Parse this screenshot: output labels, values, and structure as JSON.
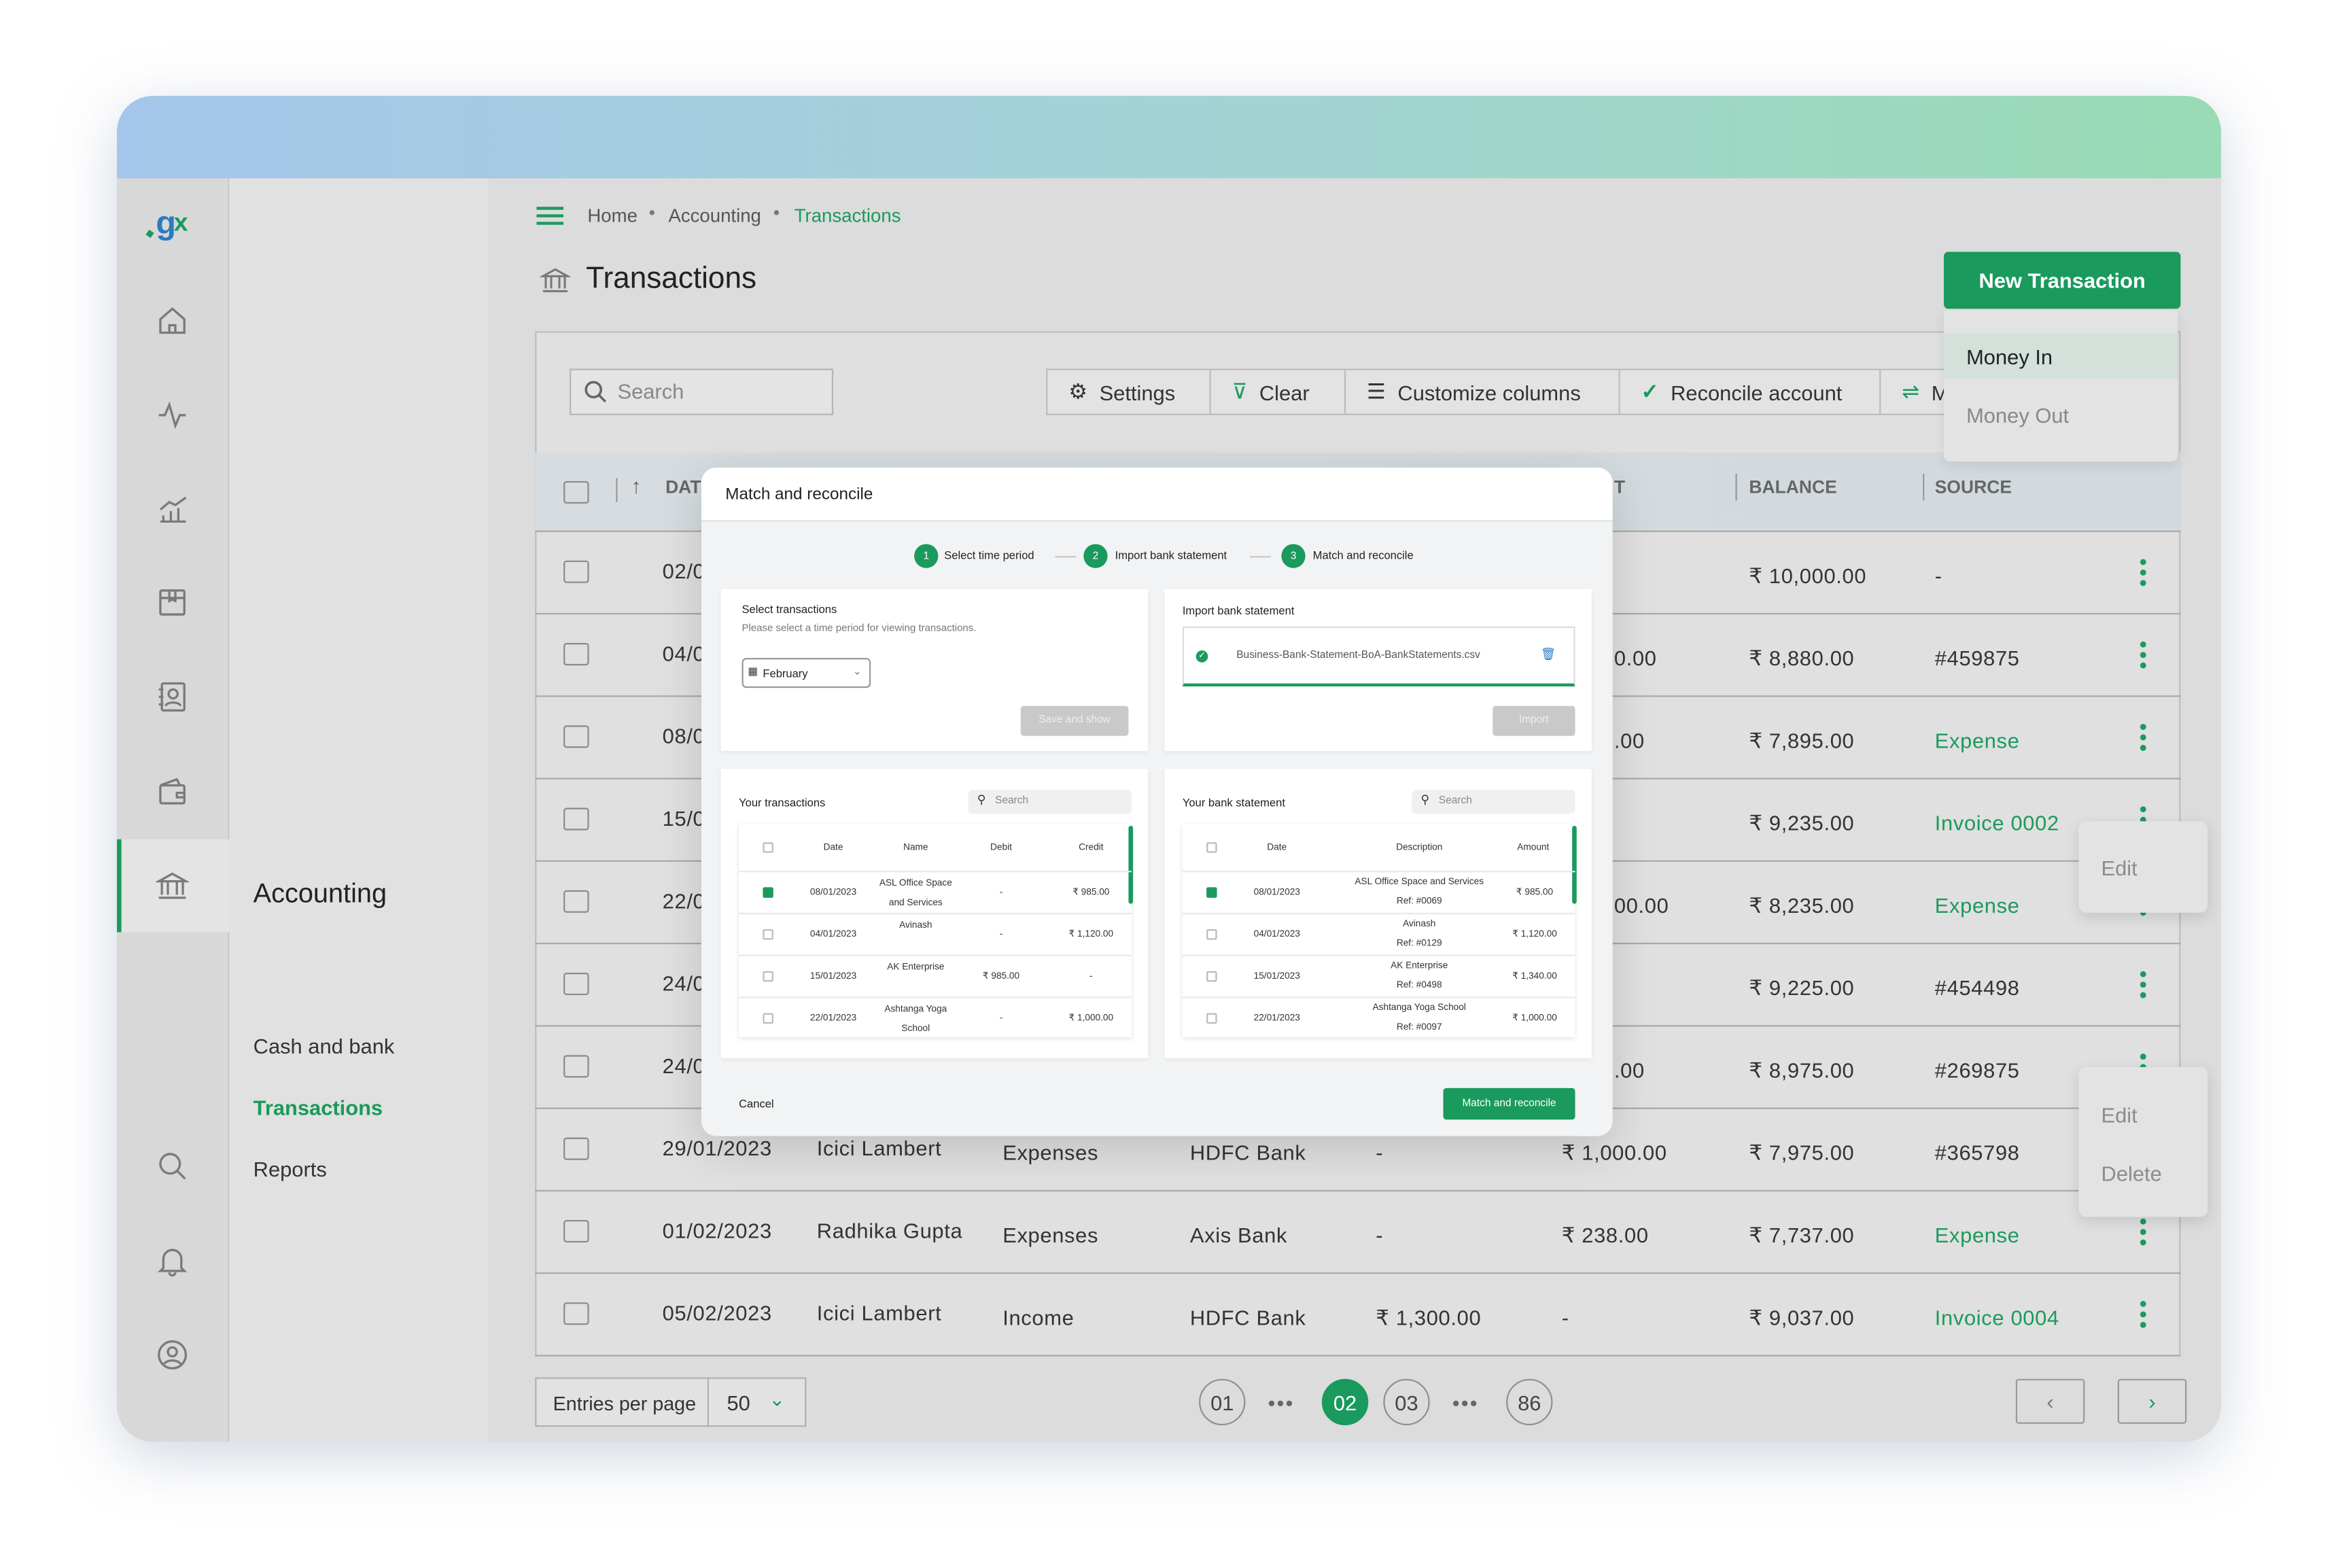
{
  "app": {
    "logo_text": "gx",
    "brand_colors": {
      "accent": "#1a9a5c",
      "logo_blue": "#2a7bc0"
    }
  },
  "sidebar": {
    "rail_icons": [
      "home-icon",
      "activity-icon",
      "chart-icon",
      "box-icon",
      "contacts-icon",
      "wallet-icon",
      "bank-icon",
      "search-icon",
      "bell-icon",
      "user-icon"
    ],
    "section_title": "Accounting",
    "items": [
      {
        "label": "Cash and bank",
        "active": false
      },
      {
        "label": "Transactions",
        "active": true
      },
      {
        "label": "Reports",
        "active": false
      }
    ]
  },
  "breadcrumb": {
    "items": [
      "Home",
      "Accounting",
      "Transactions"
    ]
  },
  "page": {
    "title": "Transactions"
  },
  "new_transaction": {
    "label": "New Transaction",
    "menu": [
      "Money In",
      "Money Out"
    ]
  },
  "toolbar": {
    "search_placeholder": "Search",
    "buttons": [
      "Settings",
      "Clear",
      "Customize columns",
      "Reconcile account",
      "M"
    ]
  },
  "table": {
    "headers": {
      "date": "DAT",
      "amount_fragment": "T",
      "balance": "BALANCE",
      "source": "SOURCE"
    },
    "rows": [
      {
        "date": "02/0",
        "credit_fragment": "",
        "balance": "₹ 10,000.00",
        "source": "-",
        "source_link": false
      },
      {
        "date": "04/0",
        "credit_fragment": "0.00",
        "balance": "₹ 8,880.00",
        "source": "#459875",
        "source_link": false
      },
      {
        "date": "08/0",
        "credit_fragment": ".00",
        "balance": "₹ 7,895.00",
        "source": "Expense",
        "source_link": true
      },
      {
        "date": "15/0",
        "credit_fragment": "",
        "balance": "₹ 9,235.00",
        "source": "Invoice 0002",
        "source_link": true
      },
      {
        "date": "22/0",
        "credit_fragment": "00.00",
        "balance": "₹ 8,235.00",
        "source": "Expense",
        "source_link": true
      },
      {
        "date": "24/0",
        "credit_fragment": "",
        "balance": "₹ 9,225.00",
        "source": "#454498",
        "source_link": false
      },
      {
        "date": "24/0",
        "credit_fragment": ".00",
        "balance": "₹ 8,975.00",
        "source": "#269875",
        "source_link": false
      },
      {
        "date": "29/01/2023",
        "name": "Icici Lambert",
        "category": "Expenses",
        "bank": "HDFC Bank",
        "debit": "-",
        "credit": "₹ 1,000.00",
        "balance": "₹ 7,975.00",
        "source": "#365798",
        "source_link": false
      },
      {
        "date": "01/02/2023",
        "name": "Radhika Gupta",
        "category": "Expenses",
        "bank": "Axis Bank",
        "debit": "-",
        "credit": "₹ 238.00",
        "balance": "₹ 7,737.00",
        "source": "Expense",
        "source_link": true
      },
      {
        "date": "05/02/2023",
        "name": "Icici Lambert",
        "category": "Income",
        "bank": "HDFC Bank",
        "debit": "₹ 1,300.00",
        "credit": "-",
        "balance": "₹ 9,037.00",
        "source": "Invoice 0004",
        "source_link": true
      }
    ]
  },
  "context_menus": [
    {
      "items": [
        "Edit"
      ]
    },
    {
      "items": [
        "Edit",
        "Delete"
      ]
    }
  ],
  "pagination": {
    "entries_label": "Entries per page",
    "entries_value": "50",
    "pages": [
      "01",
      "02",
      "03",
      "86"
    ],
    "current": "02"
  },
  "modal": {
    "title": "Match and reconcile",
    "steps": [
      "Select time period",
      "Import bank statement",
      "Match and reconcile"
    ],
    "select": {
      "title": "Select transactions",
      "subtitle": "Please select a time period for viewing transactions.",
      "month": "February",
      "button": "Save and show"
    },
    "import": {
      "title": "Import bank statement",
      "file": "Business-Bank-Statement-BoA-BankStatements.csv",
      "button": "Import"
    },
    "yours": {
      "title": "Your transactions",
      "search_placeholder": "Search",
      "headers": [
        "Date",
        "Name",
        "Debit",
        "Credit"
      ],
      "rows": [
        {
          "checked": true,
          "date": "08/01/2023",
          "name": "ASL Office Space and Services",
          "debit": "-",
          "credit": "₹ 985.00"
        },
        {
          "checked": false,
          "date": "04/01/2023",
          "name": "Avinash",
          "debit": "-",
          "credit": "₹ 1,120.00"
        },
        {
          "checked": false,
          "date": "15/01/2023",
          "name": "AK Enterprise",
          "debit": "₹ 985.00",
          "credit": "-"
        },
        {
          "checked": false,
          "date": "22/01/2023",
          "name": "Ashtanga Yoga School",
          "debit": "-",
          "credit": "₹ 1,000.00"
        }
      ]
    },
    "bank": {
      "title": "Your bank statement",
      "search_placeholder": "Search",
      "headers": [
        "Date",
        "Description",
        "Amount"
      ],
      "rows": [
        {
          "checked": true,
          "date": "08/01/2023",
          "description": "ASL Office Space and Services",
          "ref": "Ref: #0069",
          "amount": "₹ 985.00"
        },
        {
          "checked": false,
          "date": "04/01/2023",
          "description": "Avinash",
          "ref": "Ref: #0129",
          "amount": "₹ 1,120.00"
        },
        {
          "checked": false,
          "date": "15/01/2023",
          "description": "AK Enterprise",
          "ref": "Ref: #0498",
          "amount": "₹ 1,340.00"
        },
        {
          "checked": false,
          "date": "22/01/2023",
          "description": "Ashtanga Yoga School",
          "ref": "Ref: #0097",
          "amount": "₹ 1,000.00"
        }
      ]
    },
    "cancel": "Cancel",
    "confirm": "Match and reconcile"
  }
}
